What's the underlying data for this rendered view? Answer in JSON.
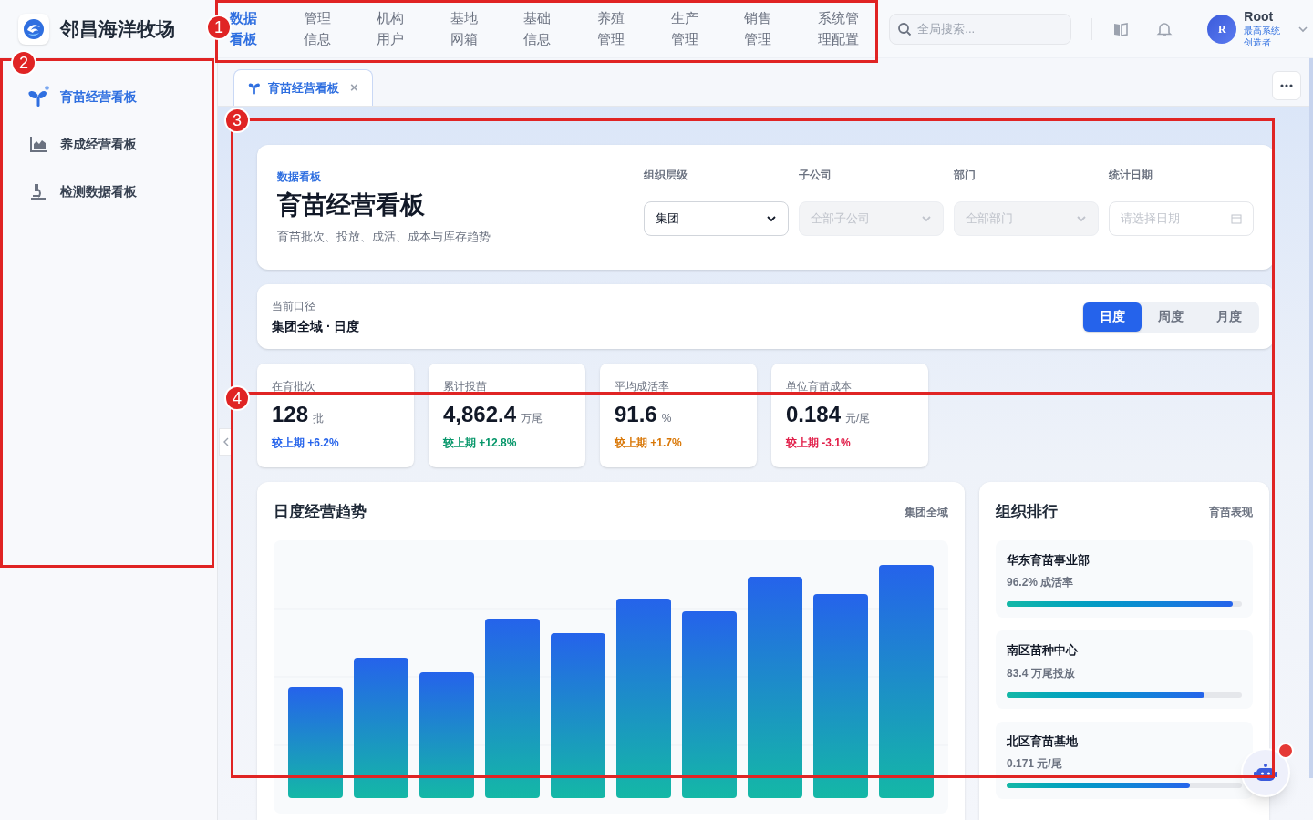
{
  "brand": {
    "name": "邻昌海洋牧场"
  },
  "nav": [
    {
      "label": "数据看板",
      "selected": true
    },
    {
      "label": "管理信息",
      "selected": false
    },
    {
      "label": "机构用户",
      "selected": false
    },
    {
      "label": "基地网箱",
      "selected": false
    },
    {
      "label": "基础信息",
      "selected": false
    },
    {
      "label": "养殖管理",
      "selected": false
    },
    {
      "label": "生产管理",
      "selected": false
    },
    {
      "label": "销售管理",
      "selected": false
    },
    {
      "label": "系统管理配置",
      "selected": false
    }
  ],
  "search": {
    "placeholder": "全局搜索..."
  },
  "user": {
    "avatar": "R",
    "name": "Root",
    "role": "最高系统创造者"
  },
  "sidebar": {
    "items": [
      {
        "label": "育苗经营看板",
        "kind": "sprout",
        "selected": true
      },
      {
        "label": "养成经营看板",
        "kind": "chart",
        "selected": false
      },
      {
        "label": "检测数据看板",
        "kind": "microscope",
        "selected": false
      }
    ]
  },
  "tabs": [
    {
      "label": "育苗经营看板",
      "close": "×",
      "selected": true
    }
  ],
  "header": {
    "eyebrow": "数据看板",
    "title": "育苗经营看板",
    "subtitle": "育苗批次、投放、成活、成本与库存趋势",
    "filters": [
      {
        "label": "组织层级",
        "kind": "select",
        "value": "集团",
        "disabled": false
      },
      {
        "label": "子公司",
        "kind": "select",
        "placeholder": "全部子公司",
        "disabled": true
      },
      {
        "label": "部门",
        "kind": "select",
        "placeholder": "全部部门",
        "disabled": true
      },
      {
        "label": "统计日期",
        "kind": "date",
        "placeholder": "请选择日期",
        "disabled": false
      }
    ]
  },
  "scope": {
    "label": "当前口径",
    "value": "集团全域 · 日度",
    "periods": [
      {
        "label": "日度",
        "selected": true
      },
      {
        "label": "周度",
        "selected": false
      },
      {
        "label": "月度",
        "selected": false
      }
    ]
  },
  "kpis": [
    {
      "label": "在育批次",
      "value": "128",
      "unit": "批",
      "trend": "较上期",
      "delta": "+6.2%",
      "color": "#2563eb"
    },
    {
      "label": "累计投苗",
      "value": "4,862.4",
      "unit": "万尾",
      "trend": "较上期",
      "delta": "+12.8%",
      "color": "#059669"
    },
    {
      "label": "平均成活率",
      "value": "91.6",
      "unit": "%",
      "trend": "较上期",
      "delta": "+1.7%",
      "color": "#d97706"
    },
    {
      "label": "单位育苗成本",
      "value": "0.184",
      "unit": "元/尾",
      "trend": "较上期",
      "delta": "-3.1%",
      "color": "#e11d48"
    }
  ],
  "trend_chart": {
    "title": "日度经营趋势",
    "scope": "集团全域"
  },
  "ranking": {
    "title": "组织排行",
    "subtitle": "育苗表现",
    "items": [
      {
        "name": "华东育苗事业部",
        "metric": "96.2% 成活率",
        "level": 0.96
      },
      {
        "name": "南区苗种中心",
        "metric": "83.4 万尾投放",
        "level": 0.84
      },
      {
        "name": "北区育苗基地",
        "metric": "0.171 元/尾",
        "level": 0.78
      }
    ]
  },
  "annotations": [
    {
      "label": "1"
    },
    {
      "label": "2"
    },
    {
      "label": "3"
    },
    {
      "label": "4"
    }
  ]
}
